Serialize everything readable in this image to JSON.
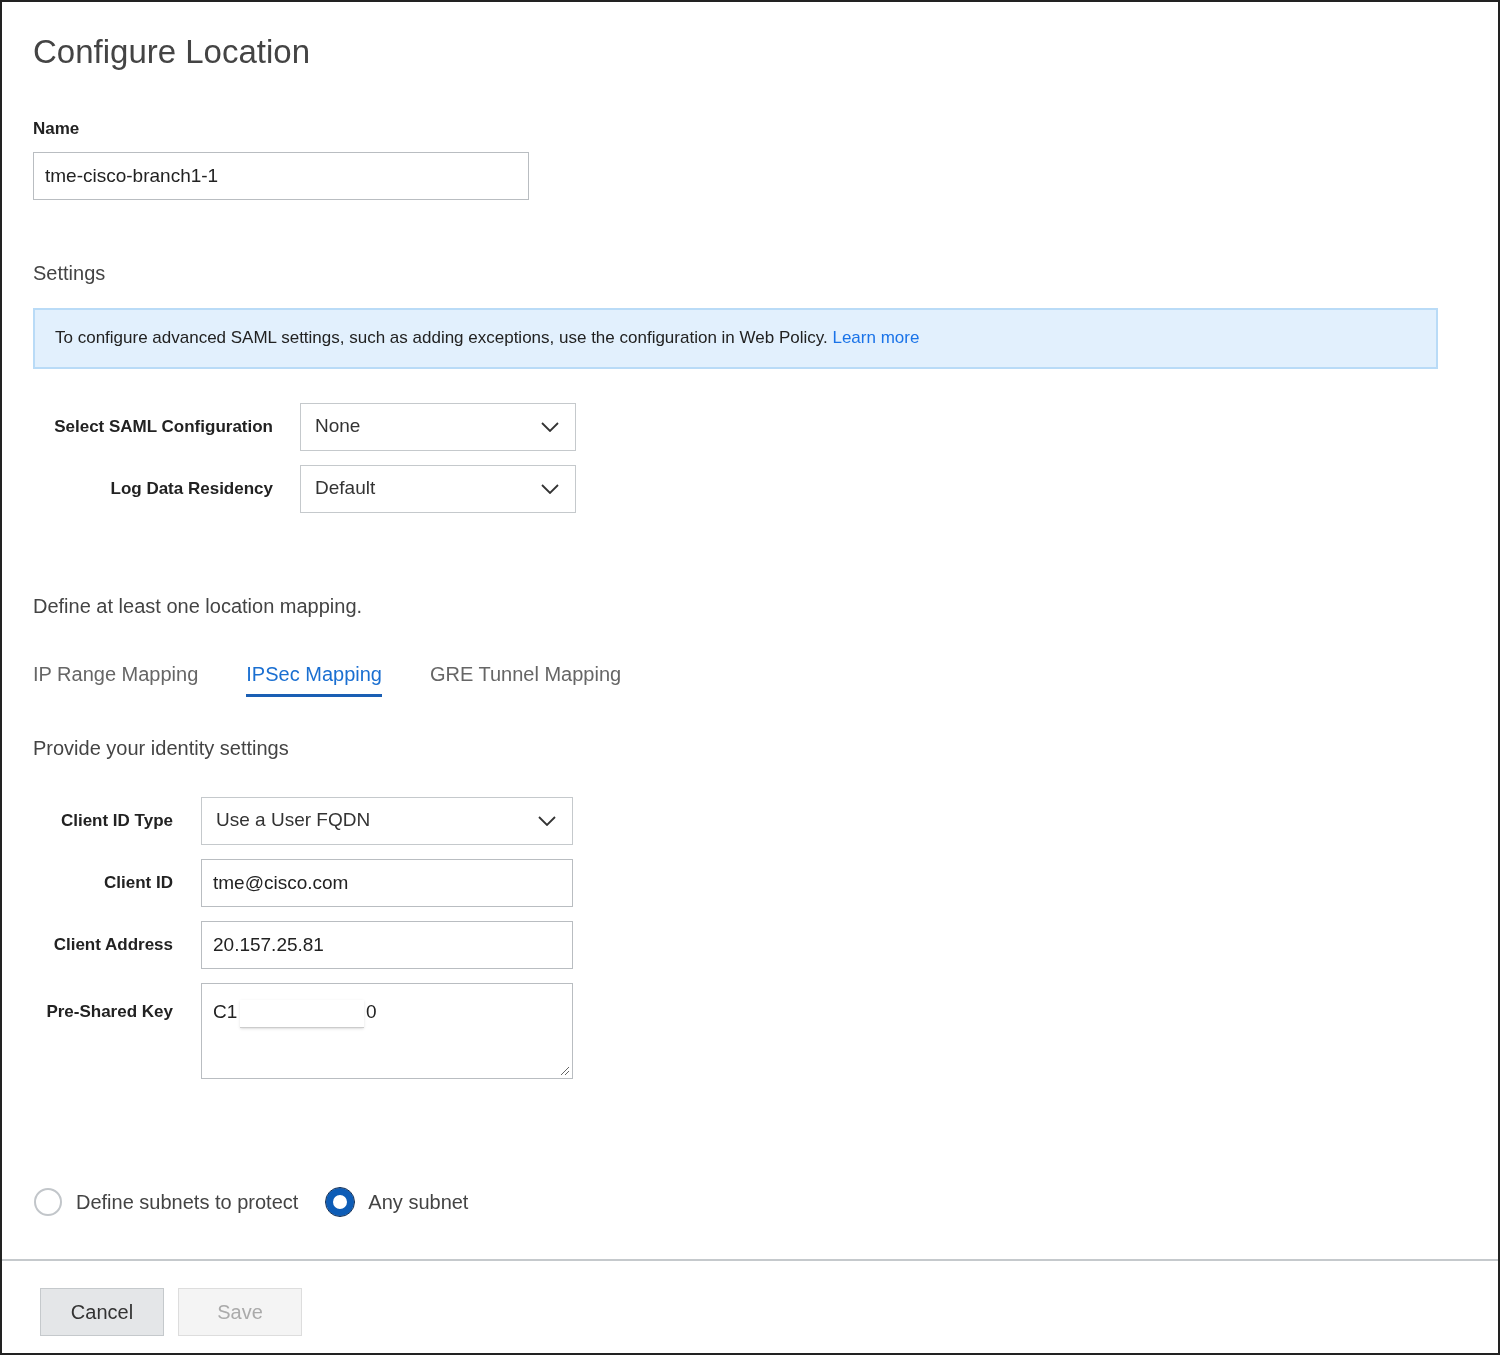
{
  "title": "Configure Location",
  "name_field": {
    "label": "Name",
    "value": "tme-cisco-branch1-1"
  },
  "settings": {
    "heading": "Settings",
    "info": "To configure advanced SAML settings, such as adding exceptions, use the configuration in Web Policy.",
    "info_link": "Learn more",
    "selects": [
      {
        "label": "Select SAML Configuration",
        "value": "None"
      },
      {
        "label": "Log Data Residency",
        "value": "Default"
      }
    ]
  },
  "mapping_heading": "Define at least one location mapping.",
  "tabs": [
    {
      "label": "IP Range Mapping",
      "selected": false
    },
    {
      "label": "IPSec Mapping",
      "selected": true
    },
    {
      "label": "GRE Tunnel Mapping",
      "selected": false
    }
  ],
  "identity": {
    "heading": "Provide your identity settings",
    "fields": [
      {
        "kind": "select",
        "label": "Client ID Type",
        "value": "Use a User FQDN"
      },
      {
        "kind": "input",
        "label": "Client ID",
        "value": "tme@cisco.com"
      },
      {
        "kind": "input",
        "label": "Client Address",
        "value": "20.157.25.81"
      },
      {
        "kind": "textarea",
        "label": "Pre-Shared Key",
        "value_start": "C1",
        "value_end": "0"
      }
    ]
  },
  "subnet_options": [
    {
      "label": "Define subnets to protect",
      "selected": false
    },
    {
      "label": "Any subnet",
      "selected": true
    }
  ],
  "buttons": [
    {
      "label": "Cancel",
      "disabled": false
    },
    {
      "label": "Save",
      "disabled": true
    }
  ]
}
